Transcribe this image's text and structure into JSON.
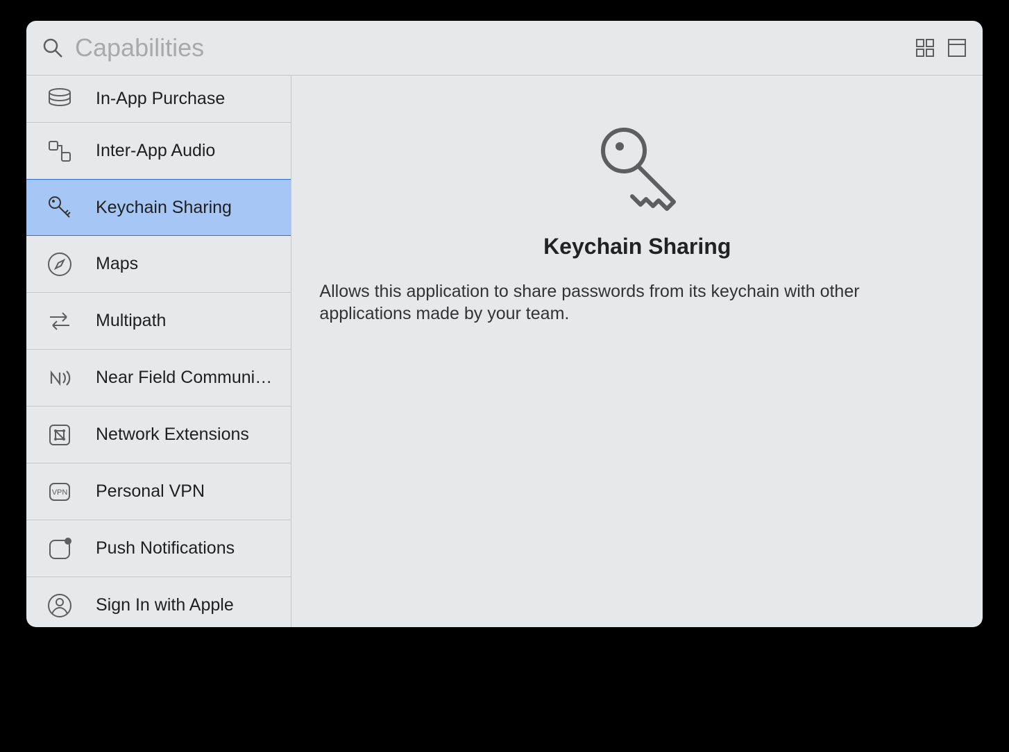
{
  "search": {
    "placeholder": "Capabilities",
    "value": ""
  },
  "sidebar": {
    "items": [
      {
        "label": "In-App Purchase",
        "selected": false,
        "icon": "coins"
      },
      {
        "label": "Inter-App Audio",
        "selected": false,
        "icon": "audio"
      },
      {
        "label": "Keychain Sharing",
        "selected": true,
        "icon": "key"
      },
      {
        "label": "Maps",
        "selected": false,
        "icon": "compass"
      },
      {
        "label": "Multipath",
        "selected": false,
        "icon": "arrows"
      },
      {
        "label": "Near Field Communication Tag R...",
        "selected": false,
        "icon": "nfc"
      },
      {
        "label": "Network Extensions",
        "selected": false,
        "icon": "network"
      },
      {
        "label": "Personal VPN",
        "selected": false,
        "icon": "vpn"
      },
      {
        "label": "Push Notifications",
        "selected": false,
        "icon": "push"
      },
      {
        "label": "Sign In with Apple",
        "selected": false,
        "icon": "person"
      }
    ]
  },
  "detail": {
    "title": "Keychain Sharing",
    "description": "Allows this application to share passwords from its keychain with other applications made by your team."
  }
}
